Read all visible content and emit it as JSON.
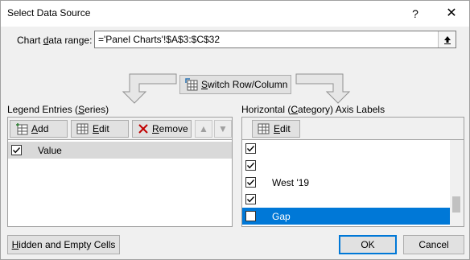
{
  "window": {
    "title": "Select Data Source",
    "help": "?",
    "close": "✕"
  },
  "range": {
    "label_pre": "Chart ",
    "label_ul": "d",
    "label_post": "ata range:",
    "value": "='Panel Charts'!$A$3:$C$32"
  },
  "switch": {
    "pre": "",
    "ul": "S",
    "post": "witch Row/Column"
  },
  "legend": {
    "heading_pre": "Legend Entries (",
    "heading_ul": "S",
    "heading_post": "eries)",
    "add_ul": "A",
    "add_post": "dd",
    "edit_ul": "E",
    "edit_post": "dit",
    "remove_ul": "R",
    "remove_post": "emove",
    "up": "▲",
    "down": "▼",
    "items": [
      {
        "label": "Value",
        "checked": true,
        "selected": true
      }
    ]
  },
  "axis": {
    "heading_pre": "Horizontal (",
    "heading_ul": "C",
    "heading_post": "ategory) Axis Labels",
    "edit_ul": "E",
    "edit_post": "dit",
    "items": [
      {
        "label": "",
        "checked": true,
        "selected": false
      },
      {
        "label": "",
        "checked": true,
        "selected": false
      },
      {
        "label": "West '19",
        "checked": true,
        "selected": false
      },
      {
        "label": "",
        "checked": true,
        "selected": false
      },
      {
        "label": "Gap",
        "checked": false,
        "selected": true
      }
    ]
  },
  "footer": {
    "hidden_ul": "H",
    "hidden_post": "idden and Empty Cells",
    "ok": "OK",
    "cancel": "Cancel"
  },
  "colors": {
    "selection": "#0078d7",
    "legend_selection": "#d9d9d9",
    "button_face": "#e1e1e1"
  }
}
